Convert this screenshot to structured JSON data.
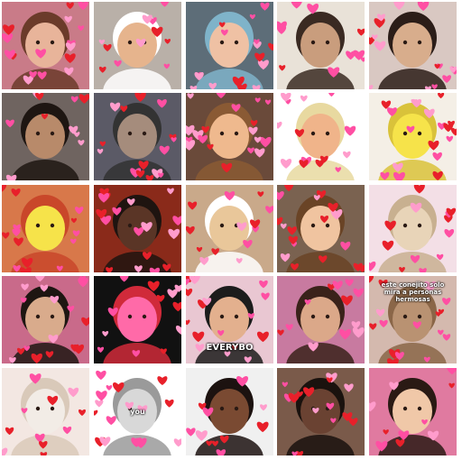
{
  "colors": {
    "heart_pink": "#ff4fa3",
    "heart_red": "#e8202a",
    "heart_light": "#ff9ccc",
    "background": "#ffffff"
  },
  "tiles": [
    {
      "id": "r1c1",
      "subject": "girl-crying",
      "bg": "#c97b88",
      "skin": "#e8b49a",
      "hair": "#6b3b2a",
      "caption": ""
    },
    {
      "id": "r1c2",
      "subject": "baby-in-towel",
      "bg": "#b9b0a8",
      "skin": "#e6b48d",
      "hair": "#ffffff",
      "caption": ""
    },
    {
      "id": "r1c3",
      "subject": "blue-hair-girl",
      "bg": "#5d6d78",
      "skin": "#efc1a4",
      "hair": "#7fb3c9",
      "caption": ""
    },
    {
      "id": "r1c4",
      "subject": "person-lying-down",
      "bg": "#e9e2d8",
      "skin": "#c99d7d",
      "hair": "#3a2a22",
      "caption": ""
    },
    {
      "id": "r1c5",
      "subject": "man-heart-hands",
      "bg": "#d9c8c2",
      "skin": "#d8ad8c",
      "hair": "#2b1d18",
      "caption": ""
    },
    {
      "id": "r2c1",
      "subject": "man-thinking",
      "bg": "#6f6460",
      "skin": "#b88a6a",
      "hair": "#1e1612",
      "caption": ""
    },
    {
      "id": "r2c2",
      "subject": "heart-wreath",
      "bg": "#5b5a66",
      "skin": "#a58c7c",
      "hair": "#333333",
      "caption": ""
    },
    {
      "id": "r2c3",
      "subject": "boy-heart-eyes",
      "bg": "#6a4a3a",
      "skin": "#efb98e",
      "hair": "#8a5a34",
      "caption": ""
    },
    {
      "id": "r2c4",
      "subject": "man-flower-crown",
      "bg": "#ffffff",
      "skin": "#f0b48a",
      "hair": "#e8d9a0",
      "caption": ""
    },
    {
      "id": "r2c5",
      "subject": "sponge-blushing",
      "bg": "#f4efe6",
      "skin": "#f6e34a",
      "hair": "#d9c23a",
      "caption": ""
    },
    {
      "id": "r3c1",
      "subject": "sponge-heart-crown",
      "bg": "#d8784a",
      "skin": "#f6e34a",
      "hair": "#c9472a",
      "caption": ""
    },
    {
      "id": "r3c2",
      "subject": "man-glasses-hearts",
      "bg": "#8a2a1a",
      "skin": "#5a3526",
      "hair": "#1e1410",
      "caption": ""
    },
    {
      "id": "r3c3",
      "subject": "cat-tongue",
      "bg": "#c9a98a",
      "skin": "#e9c79a",
      "hair": "#ffffff",
      "caption": ""
    },
    {
      "id": "r3c4",
      "subject": "boy-pointing",
      "bg": "#7a6250",
      "skin": "#f0c4a0",
      "hair": "#6a4426",
      "caption": ""
    },
    {
      "id": "r3c5",
      "subject": "chihuahua-hearts",
      "bg": "#f3dfe6",
      "skin": "#e8d4b8",
      "hair": "#c8b090",
      "caption": ""
    },
    {
      "id": "r4c1",
      "subject": "man-heart-hands-2",
      "bg": "#c96a8a",
      "skin": "#d9ab8c",
      "hair": "#1e1612",
      "caption": ""
    },
    {
      "id": "r4c2",
      "subject": "hearts-pile-dark",
      "bg": "#111111",
      "skin": "#ff6aa8",
      "hair": "#d02a3a",
      "caption": ""
    },
    {
      "id": "r4c3",
      "subject": "girl-hoodie-everybody",
      "bg": "#e9c7d2",
      "skin": "#e3b08e",
      "hair": "#1c1c1c",
      "caption": "EVERYBO"
    },
    {
      "id": "r4c4",
      "subject": "woman-heart-hands",
      "bg": "#c87aa0",
      "skin": "#dba889",
      "hair": "#3a221a",
      "caption": ""
    },
    {
      "id": "r4c5",
      "subject": "squirrel-caption",
      "bg": "#d4b9ae",
      "skin": "#b99272",
      "hair": "#8a6648",
      "caption": "este conejito solo mira a personas hermosas"
    },
    {
      "id": "r5c1",
      "subject": "cat-hearts-white",
      "bg": "#f3e7e2",
      "skin": "#f2ece6",
      "hair": "#d9c9b9",
      "caption": ""
    },
    {
      "id": "r5c2",
      "subject": "two-cats-hug",
      "bg": "#ffffff",
      "skin": "#d8d8d8",
      "hair": "#9a9a9a",
      "caption": "you"
    },
    {
      "id": "r5c3",
      "subject": "woman-laughing",
      "bg": "#f0f0f0",
      "skin": "#7a4a32",
      "hair": "#1c1210",
      "caption": ""
    },
    {
      "id": "r5c4",
      "subject": "man-curly-hair",
      "bg": "#7a5a4a",
      "skin": "#6a4232",
      "hair": "#1a120e",
      "caption": ""
    },
    {
      "id": "r5c5",
      "subject": "emoji-faces-girl",
      "bg": "#e07aa0",
      "skin": "#f0c8a8",
      "hair": "#2a1a14",
      "caption": ""
    }
  ]
}
